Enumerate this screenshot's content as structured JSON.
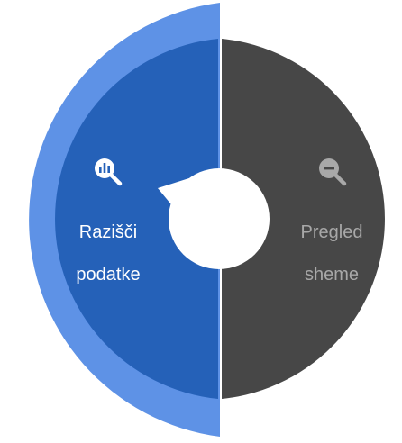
{
  "menu": {
    "left": {
      "label_line1": "Razišči",
      "label_line2": "podatke",
      "icon": "magnifier-chart-icon",
      "state": "selected"
    },
    "right": {
      "label_line1": "Pregled",
      "label_line2": "sheme",
      "icon": "zoom-out-icon",
      "state": "normal"
    }
  },
  "colors": {
    "selected_outer": "#5e92e6",
    "selected_inner": "#2561b8",
    "normal": "#474747",
    "text_selected": "#ffffff",
    "text_normal": "#a8a8a8",
    "center": "#ffffff"
  }
}
